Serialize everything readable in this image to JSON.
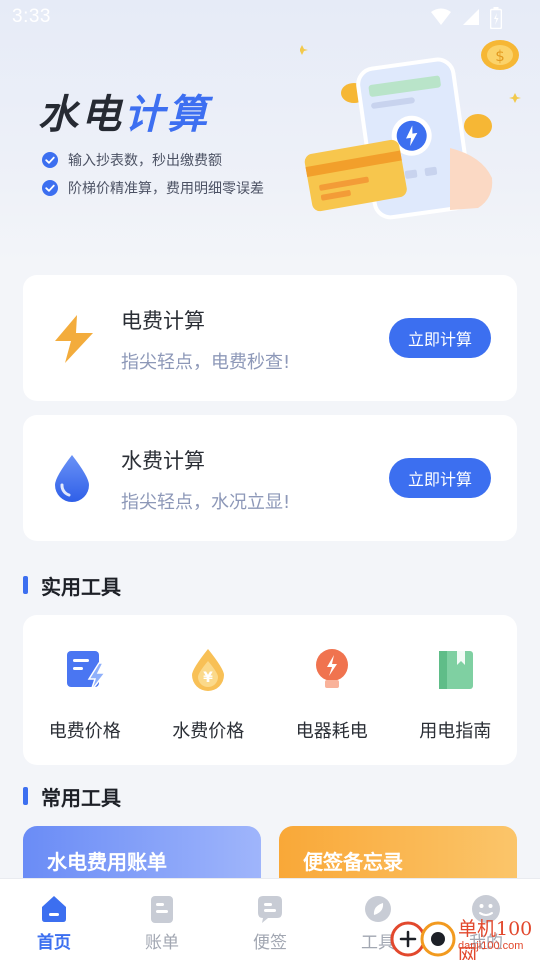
{
  "status_bar": {
    "time": "3:33",
    "icons": [
      "wifi-icon",
      "signal-icon",
      "battery-icon"
    ]
  },
  "banner": {
    "title_part1": "水电",
    "title_part2": "计算",
    "features": [
      {
        "text": "输入抄表数，秒出缴费额",
        "icon": "check-circle-icon"
      },
      {
        "text": "阶梯价精准算，费用明细零误差",
        "icon": "check-circle-icon"
      }
    ]
  },
  "cards": {
    "electricity": {
      "title": "电费计算",
      "subtitle": "指尖轻点，电费秒查!",
      "button": "立即计算",
      "icon": "lightning-icon"
    },
    "water": {
      "title": "水费计算",
      "subtitle": "指尖轻点，水况立显!",
      "button": "立即计算",
      "icon": "water-drop-icon"
    }
  },
  "sections": {
    "practical": "实用工具",
    "common": "常用工具"
  },
  "tools": [
    {
      "label": "电费价格",
      "icon": "electricity-price-icon"
    },
    {
      "label": "水费价格",
      "icon": "water-price-icon"
    },
    {
      "label": "电器耗电",
      "icon": "bulb-icon"
    },
    {
      "label": "用电指南",
      "icon": "guide-book-icon"
    }
  ],
  "common_tools": [
    {
      "label": "水电费用账单"
    },
    {
      "label": "便签备忘录"
    }
  ],
  "nav": [
    {
      "label": "首页",
      "icon": "home-icon",
      "active": true
    },
    {
      "label": "账单",
      "icon": "bill-icon",
      "active": false
    },
    {
      "label": "便签",
      "icon": "note-icon",
      "active": false
    },
    {
      "label": "工具",
      "icon": "tools-icon",
      "active": false
    },
    {
      "label": "我的",
      "icon": "profile-icon",
      "active": false
    }
  ],
  "watermark": {
    "line1": "单机100网",
    "line2": "danji100.com"
  },
  "colors": {
    "accent": "#3c6ff0",
    "bolt": "#f3ac3c",
    "memo": "#f9a838",
    "muted_text": "#8d98b8"
  }
}
